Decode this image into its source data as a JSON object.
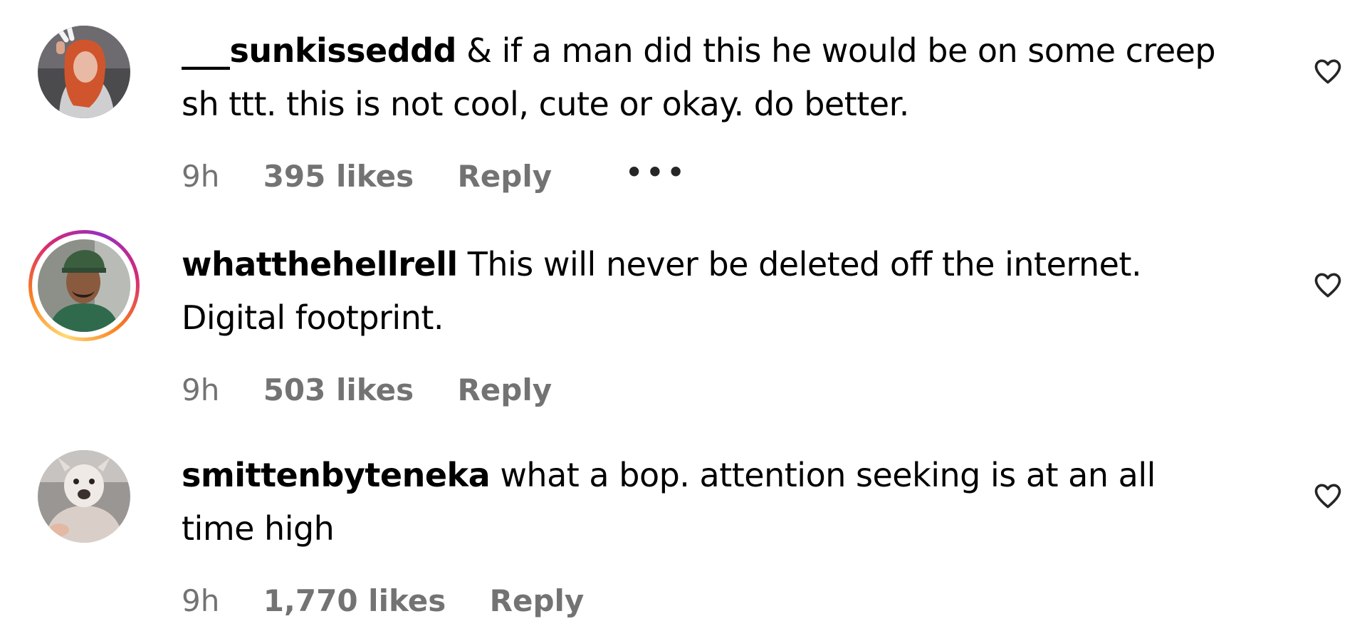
{
  "comments": [
    {
      "username": "___sunkisseddd",
      "text": "& if a man did this he would be on some creep sh ttt. this is not cool, cute or okay. do better.",
      "time": "9h",
      "likes": "395 likes",
      "reply": "Reply",
      "more": "•••",
      "avatar_icon": "user-avatar-red-hair",
      "has_story_ring": false
    },
    {
      "username": "whatthehellrell",
      "text": "This will never be deleted off the internet. Digital footprint.",
      "time": "9h",
      "likes": "503 likes",
      "reply": "Reply",
      "avatar_icon": "user-avatar-green-cap",
      "has_story_ring": true
    },
    {
      "username": "smittenbyteneka",
      "text": "what a bop. attention seeking is at an all time high",
      "time": "9h",
      "likes": "1,770 likes",
      "reply": "Reply",
      "avatar_icon": "user-avatar-dog",
      "has_story_ring": false
    }
  ],
  "colors": {
    "text": "#000000",
    "meta": "#737373",
    "heart_stroke": "#262626",
    "story_ring_start": "#feda75",
    "story_ring_mid": "#d62976"
  },
  "icons": {
    "like": "heart-outline-icon",
    "more": "ellipsis-icon"
  }
}
